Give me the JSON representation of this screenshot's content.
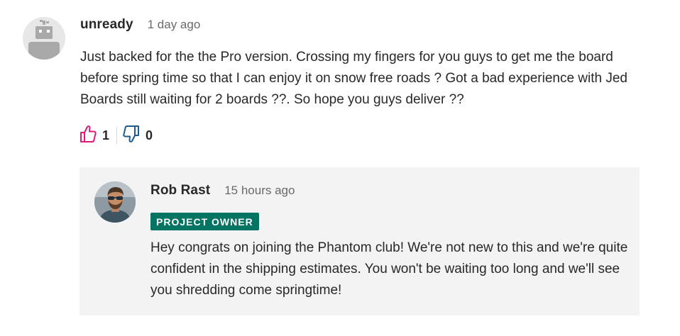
{
  "comment": {
    "author": "unready",
    "timestamp": "1 day ago",
    "avatar_icon": "robot-avatar-icon",
    "text": "Just backed for the the Pro version. Crossing my fingers for you guys to get me the board before spring time so that I can enjoy it on snow free roads ? Got a bad experience with Jed Boards still waiting for 2 boards ??. So hope you guys deliver ??",
    "upvotes": "1",
    "downvotes": "0"
  },
  "reply": {
    "author": "Rob Rast",
    "timestamp": "15 hours ago",
    "badge": "PROJECT OWNER",
    "text": "Hey congrats on joining the Phantom club! We're not new to this and we're quite confident in the shipping estimates. You won't be waiting too long and we'll see you shredding come springtime!"
  },
  "colors": {
    "badge_bg": "#037362",
    "upvote_icon": "#e2197a",
    "downvote_icon": "#1e5a8a",
    "reply_bg": "#f3f3f3"
  }
}
